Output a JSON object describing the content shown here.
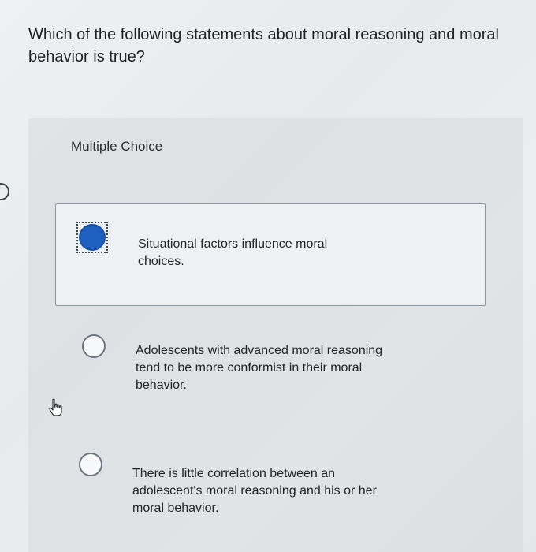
{
  "question": {
    "text": "Which of the following statements about moral reasoning and moral behavior is true?"
  },
  "section": {
    "label": "Multiple Choice"
  },
  "options": [
    {
      "text": "Situational factors influence moral choices.",
      "selected": true
    },
    {
      "text": "Adolescents with advanced moral reasoning tend to be more conformist in their moral behavior.",
      "selected": false
    },
    {
      "text": "There is little correlation between an adolescent's moral reasoning and his or her moral behavior.",
      "selected": false
    }
  ],
  "colors": {
    "selected_radio": "#1f5fbf",
    "selected_border": "#8a96a1"
  },
  "icons": {
    "cursor": "hand-pointer-icon"
  }
}
